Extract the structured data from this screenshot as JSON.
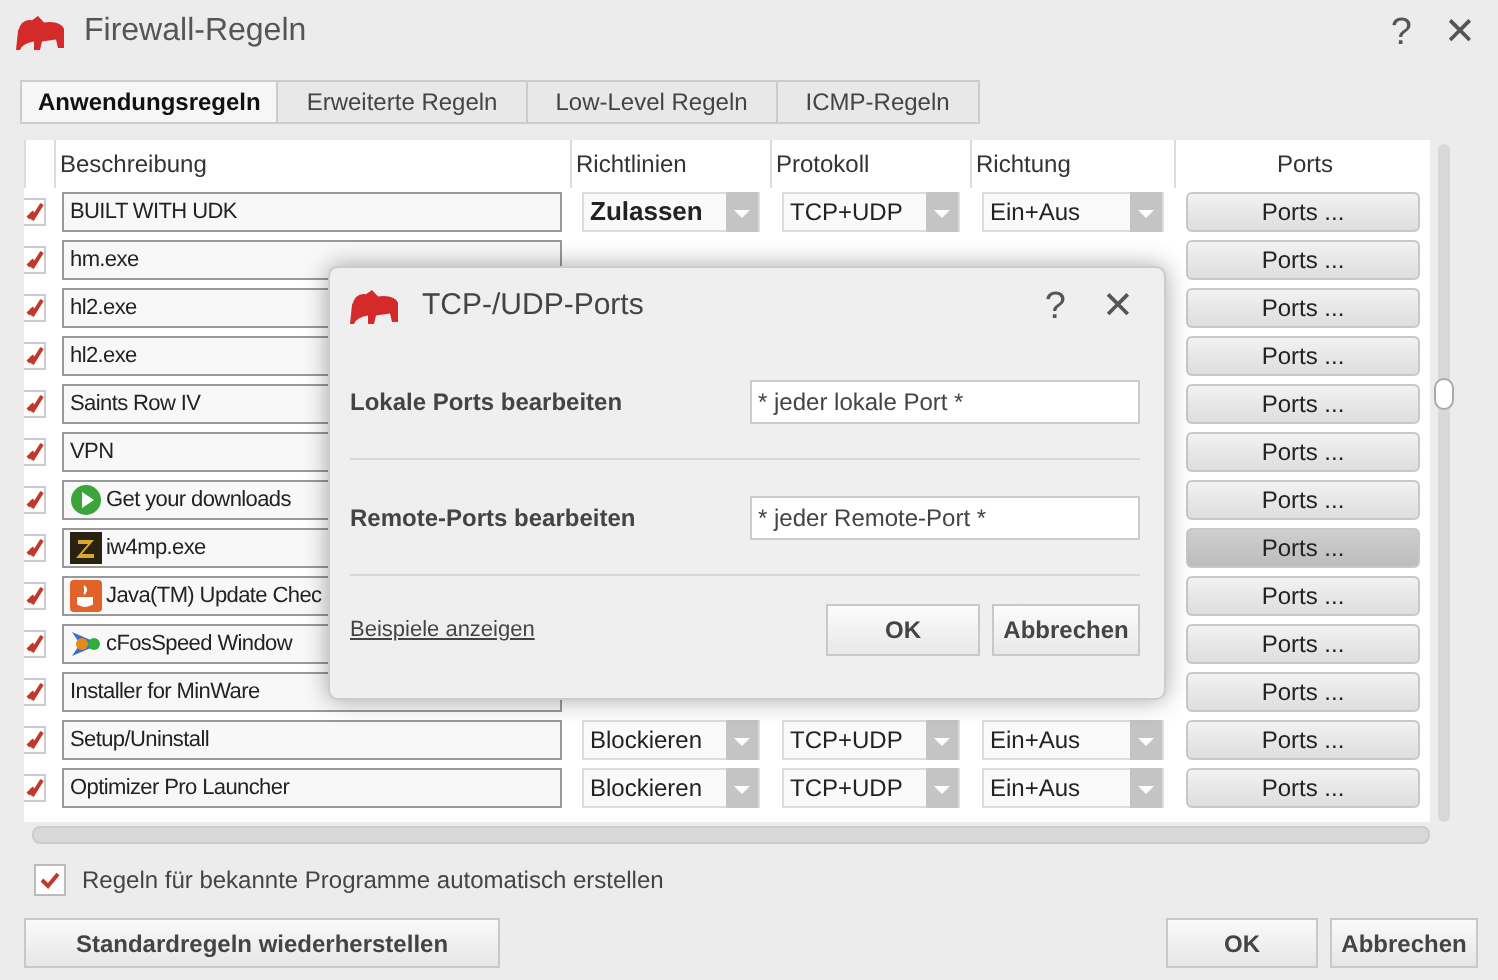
{
  "window": {
    "title": "Firewall-Regeln",
    "help": "?",
    "close": "✕"
  },
  "tabs": [
    {
      "label": "Anwendungsregeln",
      "selected": true
    },
    {
      "label": "Erweiterte Regeln",
      "selected": false
    },
    {
      "label": "Low-Level Regeln",
      "selected": false
    },
    {
      "label": "ICMP-Regeln",
      "selected": false
    }
  ],
  "columns": [
    "Beschreibung",
    "Richtlinien",
    "Protokoll",
    "Richtung",
    "Ports"
  ],
  "rows": [
    {
      "enabled": true,
      "description": "BUILT WITH UDK",
      "policy": {
        "text": "Zulassen",
        "allowed": true
      },
      "protocol": "TCP+UDP",
      "direction": "Ein+Aus",
      "ports": "Ports ...",
      "highlighted": false
    },
    {
      "enabled": true,
      "description": "hm.exe",
      "ports": "Ports ...",
      "highlighted": false
    },
    {
      "enabled": true,
      "description": "hl2.exe",
      "ports": "Ports ...",
      "highlighted": false
    },
    {
      "enabled": true,
      "description": "hl2.exe",
      "ports": "Ports ...",
      "highlighted": false
    },
    {
      "enabled": true,
      "description": "Saints Row IV",
      "ports": "Ports ...",
      "highlighted": false
    },
    {
      "enabled": true,
      "description": "VPN",
      "ports": "Ports ...",
      "highlighted": false
    },
    {
      "enabled": true,
      "kind": "play",
      "description": "Get your downloads",
      "ports": "Ports ...",
      "highlighted": false
    },
    {
      "enabled": true,
      "kind": "game",
      "description": "iw4mp.exe",
      "ports": "Ports ...",
      "highlighted": true
    },
    {
      "enabled": true,
      "kind": "cup",
      "description": "Java(TM) Update Chec",
      "ports": "Ports ...",
      "highlighted": false
    },
    {
      "enabled": true,
      "kind": "speed",
      "description": "cFosSpeed Window",
      "ports": "Ports ...",
      "highlighted": false
    },
    {
      "enabled": true,
      "description": "Installer for MinWare",
      "ports": "Ports ...",
      "highlighted": false
    },
    {
      "enabled": true,
      "description": "Setup/Uninstall",
      "policy": {
        "text": "Blockieren",
        "allowed": false
      },
      "protocol": "TCP+UDP",
      "direction": "Ein+Aus",
      "ports": "Ports ...",
      "highlighted": false
    },
    {
      "enabled": true,
      "description": "Optimizer Pro Launcher",
      "policy": {
        "text": "Blockieren",
        "allowed": false
      },
      "protocol": "TCP+UDP",
      "direction": "Ein+Aus",
      "ports": "Ports ...",
      "highlighted": false
    }
  ],
  "auto_rules": {
    "label": "Regeln für bekannte Programme automatisch erstellen",
    "checked": true
  },
  "buttons": {
    "restore": "Standardregeln wiederherstellen",
    "ok": "OK",
    "cancel": "Abbrechen"
  },
  "dialog": {
    "title": "TCP-/UDP-Ports",
    "help": "?",
    "close": "✕",
    "fields": [
      {
        "label": "Lokale Ports bearbeiten",
        "value": "* jeder lokale Port *"
      },
      {
        "label": "Remote-Ports bearbeiten",
        "value": "* jeder Remote-Port *"
      }
    ],
    "link": "Beispiele anzeigen",
    "ok": "OK",
    "cancel": "Abbrechen"
  }
}
